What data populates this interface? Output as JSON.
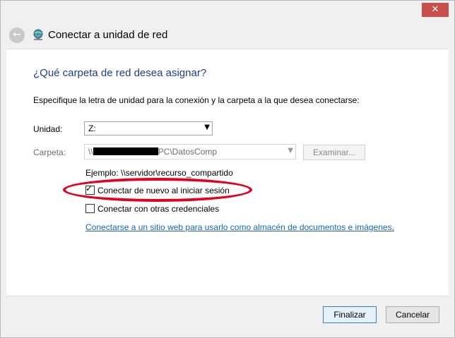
{
  "window": {
    "title": "Conectar a unidad de red",
    "close_glyph": "✕",
    "back_glyph": "←",
    "back_icon": "back-arrow-icon",
    "title_icon": "network-drive-icon"
  },
  "main": {
    "heading": "¿Qué carpeta de red desea asignar?",
    "instruction": "Especifique la letra de unidad para la conexión y la carpeta a la que desea conectarse:",
    "drive": {
      "label": "Unidad:",
      "value": "Z:"
    },
    "folder": {
      "label": "Carpeta:",
      "value_prefix": "\\\\",
      "value_suffix": "PC\\DatosComp"
    },
    "browse_label": "Examinar...",
    "example": "Ejemplo: \\\\servidor\\recurso_compartido",
    "reconnect": {
      "label": "Conectar de nuevo al iniciar sesión",
      "checked": true
    },
    "other_credentials": {
      "label": "Conectar con otras credenciales",
      "checked": false
    },
    "link_text": "Conectarse a un sitio web para usarlo como almacén de documentos e imágenes",
    "link_suffix": "."
  },
  "footer": {
    "finish_label": "Finalizar",
    "cancel_label": "Cancelar"
  },
  "colors": {
    "heading": "#1f3d8a",
    "link": "#1a66b5",
    "close_button": "#c7504a",
    "highlight": "#e6001f"
  }
}
